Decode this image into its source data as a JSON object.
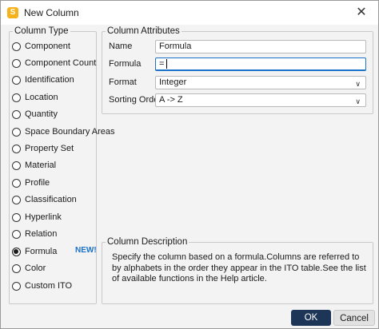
{
  "window": {
    "title": "New Column",
    "app_icon_letter": "S"
  },
  "column_type": {
    "legend": "Column Type",
    "options": [
      {
        "label": "Component",
        "selected": false
      },
      {
        "label": "Component Count",
        "selected": false
      },
      {
        "label": "Identification",
        "selected": false
      },
      {
        "label": "Location",
        "selected": false
      },
      {
        "label": "Quantity",
        "selected": false
      },
      {
        "label": "Space Boundary Areas",
        "selected": false
      },
      {
        "label": "Property Set",
        "selected": false
      },
      {
        "label": "Material",
        "selected": false
      },
      {
        "label": "Profile",
        "selected": false
      },
      {
        "label": "Classification",
        "selected": false
      },
      {
        "label": "Hyperlink",
        "selected": false
      },
      {
        "label": "Relation",
        "selected": false
      },
      {
        "label": "Formula",
        "selected": true,
        "badge": "NEW!"
      },
      {
        "label": "Color",
        "selected": false
      },
      {
        "label": "Custom ITO",
        "selected": false
      }
    ]
  },
  "attributes": {
    "legend": "Column Attributes",
    "name_label": "Name",
    "name_value": "Formula",
    "formula_label": "Formula",
    "formula_value": "=",
    "format_label": "Format",
    "format_value": "Integer",
    "sorting_label": "Sorting Order",
    "sorting_value": "A -> Z"
  },
  "description": {
    "legend": "Column Description",
    "text": "Specify the column based on a formula.Columns are referred to by alphabets in the order they appear in the ITO table.See the list of available functions in the Help article."
  },
  "buttons": {
    "ok": "OK",
    "cancel": "Cancel"
  },
  "colors": {
    "accent": "#1a73c8",
    "ok_button": "#1d3557",
    "badge": "#1a73c8"
  }
}
